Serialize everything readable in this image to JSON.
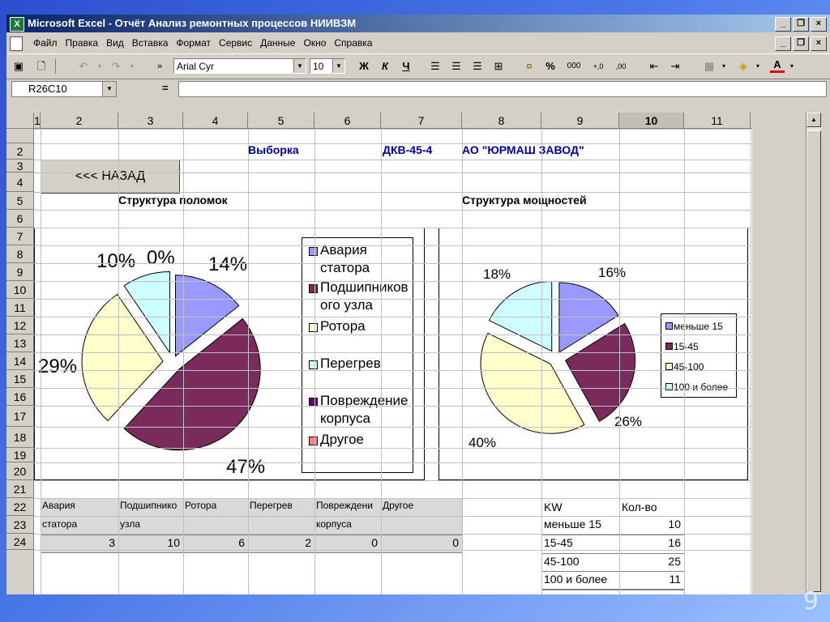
{
  "window": {
    "title": "Microsoft Excel - Отчёт Анализ ремонтных процессов НИИВЗМ",
    "app_icon_glyph": "X"
  },
  "menu": [
    "Файл",
    "Правка",
    "Вид",
    "Вставка",
    "Формат",
    "Сервис",
    "Данные",
    "Окно",
    "Справка"
  ],
  "toolbar": {
    "font_name": "Arial Cyr",
    "font_size": "10",
    "bold": "Ж",
    "italic": "К",
    "underline": "Ч",
    "percent": "%",
    "thousands": "000",
    "inc_decimal": "+,0",
    "dec_decimal": ",00"
  },
  "formula_bar": {
    "name_box": "R26C10",
    "equals": "="
  },
  "columns": [
    "1",
    "2",
    "3",
    "4",
    "5",
    "6",
    "7",
    "8",
    "9",
    "10",
    "11"
  ],
  "active_column": "10",
  "rows": [
    "2",
    "3",
    "4",
    "5",
    "6",
    "7",
    "8",
    "9",
    "10",
    "11",
    "12",
    "13",
    "14",
    "15",
    "16",
    "17",
    "18",
    "19",
    "20",
    "21",
    "22",
    "23",
    "24"
  ],
  "header": {
    "back_button": "<<< НАЗАД",
    "sample_label": "Выборка",
    "model": "ДКВ-45-4",
    "company": "АО \"ЮРМАШ ЗАВОД\""
  },
  "section_titles": {
    "breakdowns": "Структура поломок",
    "power": "Структура  мощностей"
  },
  "breakdown_table": {
    "headers": [
      [
        "Авария",
        "статора"
      ],
      [
        "Подшипнико",
        "узла"
      ],
      [
        "Ротора",
        ""
      ],
      [
        "Перегрев",
        ""
      ],
      [
        "Повреждени",
        "корпуса"
      ],
      [
        "Другое",
        ""
      ]
    ],
    "values": [
      "3",
      "10",
      "6",
      "2",
      "0",
      "0"
    ]
  },
  "power_table": {
    "headers": [
      "KW",
      "Кол-во"
    ],
    "rows": [
      [
        "меньше 15",
        "10"
      ],
      [
        "15-45",
        "16"
      ],
      [
        "45-100",
        "25"
      ],
      [
        "100 и более",
        "11"
      ]
    ]
  },
  "chart_data": [
    {
      "type": "pie",
      "categories": [
        "Авария статора",
        "Подшипникового узла",
        "Ротора",
        "Перегрев",
        "Повреждение корпуса",
        "Другое"
      ],
      "legend_labels": [
        [
          "Авария",
          "статора"
        ],
        [
          "Подшипников",
          "ого  узла"
        ],
        [
          "Ротора"
        ],
        [
          " Перегрев"
        ],
        [
          "Повреждение",
          "корпуса"
        ],
        [
          "Другое"
        ]
      ],
      "values": [
        3,
        10,
        6,
        2,
        0,
        0
      ],
      "percent_labels": [
        "14%",
        "47%",
        "29%",
        "10%",
        "0%",
        "0%"
      ],
      "colors": [
        "#9999ff",
        "#7b2a5c",
        "#ffffcc",
        "#ccffff",
        "#660066",
        "#ff8080"
      ],
      "legend": "right"
    },
    {
      "type": "pie",
      "categories": [
        "меньше 15",
        "15-45",
        "45-100",
        "100 и более"
      ],
      "values": [
        10,
        16,
        25,
        11
      ],
      "percent_labels": [
        "16%",
        "26%",
        "40%",
        "18%"
      ],
      "colors": [
        "#9999ff",
        "#7b2a5c",
        "#ffffcc",
        "#ccffff"
      ],
      "legend": "right"
    }
  ],
  "slide_number": "9"
}
